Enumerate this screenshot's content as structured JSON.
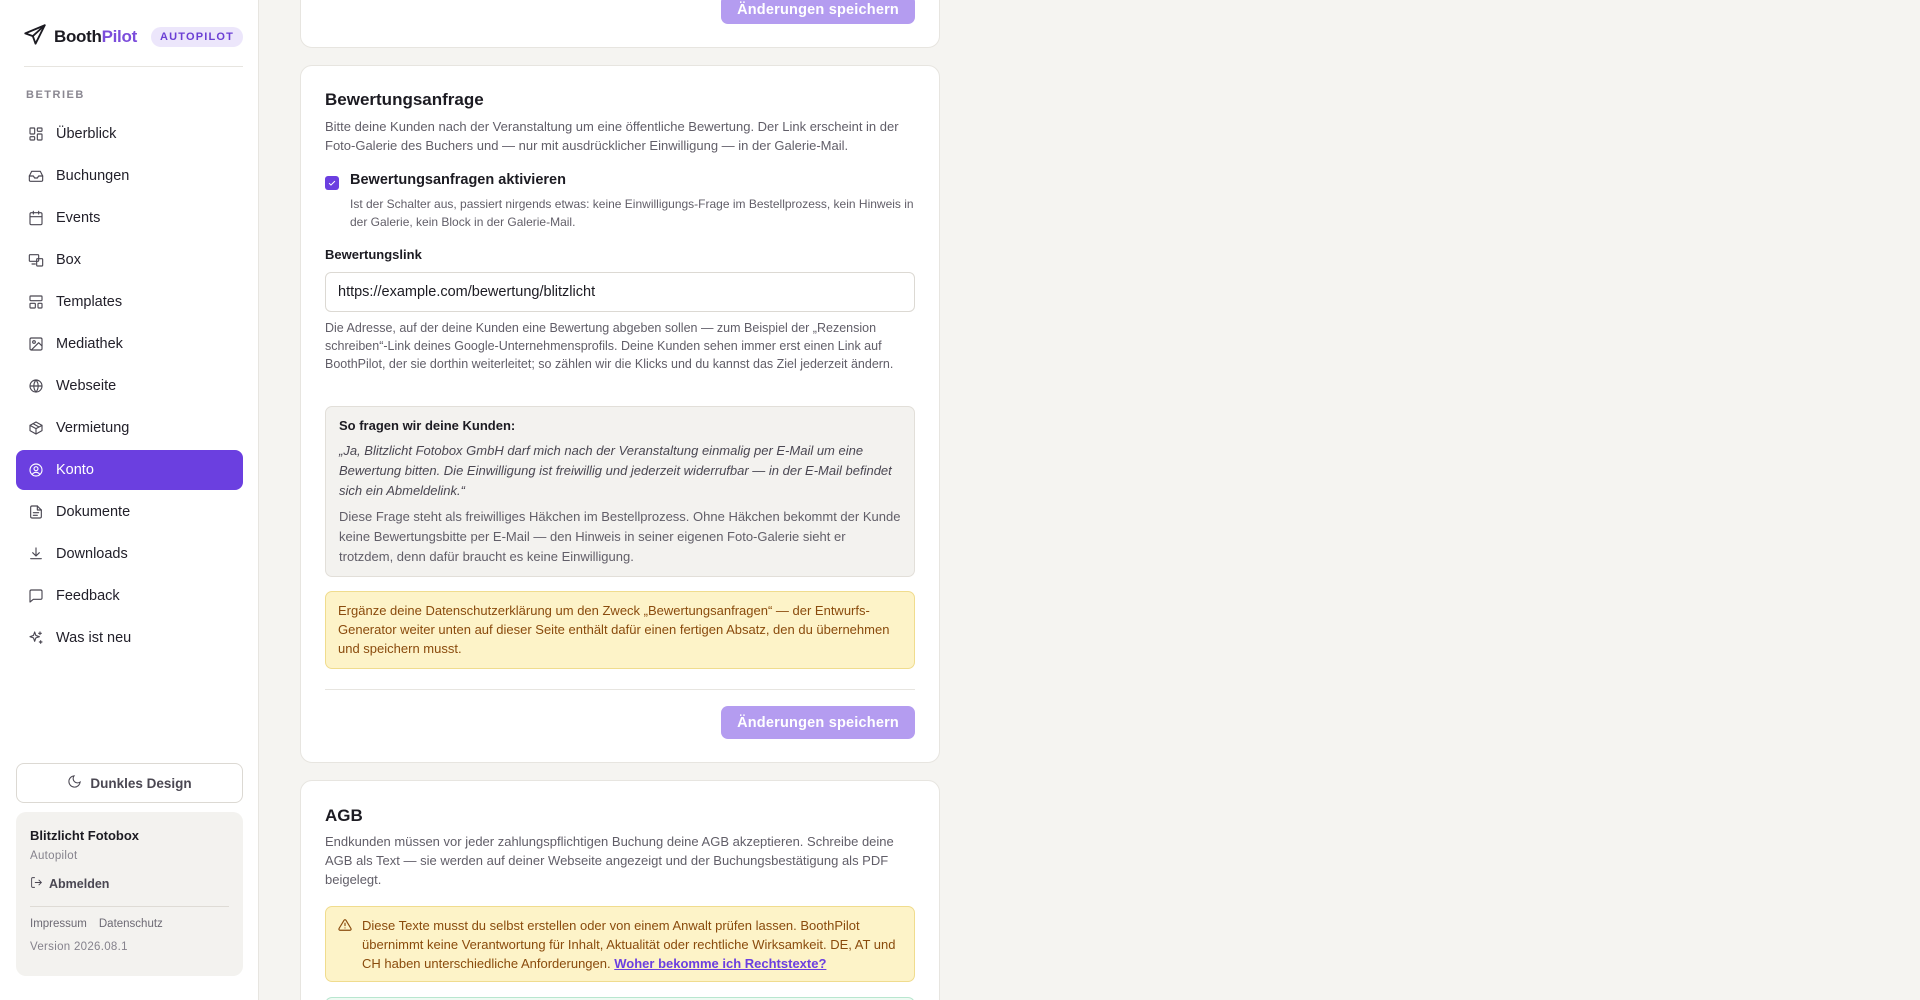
{
  "brand": {
    "name_part1": "Booth",
    "name_part2": "Pilot",
    "badge": "AUTOPILOT"
  },
  "sidebar": {
    "section": "BETRIEB",
    "items": [
      {
        "label": "Überblick",
        "icon": "dashboard-icon"
      },
      {
        "label": "Buchungen",
        "icon": "inbox-icon"
      },
      {
        "label": "Events",
        "icon": "calendar-icon"
      },
      {
        "label": "Box",
        "icon": "devices-icon"
      },
      {
        "label": "Templates",
        "icon": "layout-icon"
      },
      {
        "label": "Mediathek",
        "icon": "image-icon"
      },
      {
        "label": "Webseite",
        "icon": "globe-icon"
      },
      {
        "label": "Vermietung",
        "icon": "package-icon"
      },
      {
        "label": "Konto",
        "icon": "user-circle-icon",
        "active": true
      },
      {
        "label": "Dokumente",
        "icon": "file-icon"
      },
      {
        "label": "Downloads",
        "icon": "download-icon"
      },
      {
        "label": "Feedback",
        "icon": "message-icon"
      },
      {
        "label": "Was ist neu",
        "icon": "sparkles-icon"
      }
    ],
    "dark_mode_label": "Dunkles Design",
    "account": {
      "name": "Blitzlicht Fotobox",
      "plan": "Autopilot",
      "logout": "Abmelden",
      "imprint": "Impressum",
      "privacy": "Datenschutz",
      "version": "Version 2026.08.1"
    }
  },
  "top_card": {
    "save_label": "Änderungen speichern"
  },
  "review_card": {
    "title": "Bewertungsanfrage",
    "description": "Bitte deine Kunden nach der Veranstaltung um eine öffentliche Bewertung. Der Link erscheint in der Foto-Galerie des Buchers und — nur mit ausdrücklicher Einwilligung — in der Galerie-Mail.",
    "toggle_label": "Bewertungsanfragen aktivieren",
    "toggle_checked": true,
    "toggle_help": "Ist der Schalter aus, passiert nirgends etwas: keine Einwilligungs-Frage im Bestellprozess, kein Hinweis in der Galerie, kein Block in der Galerie-Mail.",
    "link_label": "Bewertungslink",
    "link_value": "https://example.com/bewertung/blitzlicht",
    "link_help": "Die Adresse, auf der deine Kunden eine Bewertung abgeben sollen — zum Beispiel der „Rezension schreiben“-Link deines Google-Unternehmensprofils. Deine Kunden sehen immer erst einen Link auf BoothPilot, der sie dorthin weiterleitet; so zählen wir die Klicks und du kannst das Ziel jederzeit ändern.",
    "ask_title": "So fragen wir deine Kunden:",
    "ask_quote": "„Ja, Blitzlicht Fotobox GmbH darf mich nach der Veranstaltung einmalig per E-Mail um eine Bewertung bitten. Die Einwilligung ist freiwillig und jederzeit widerrufbar — in der E-Mail befindet sich ein Abmeldelink.“",
    "ask_note": "Diese Frage steht als freiwilliges Häkchen im Bestellprozess. Ohne Häkchen bekommt der Kunde keine Bewertungsbitte per E-Mail — den Hinweis in seiner eigenen Foto-Galerie sieht er trotzdem, denn dafür braucht es keine Einwilligung.",
    "privacy_notice": "Ergänze deine Datenschutzerklärung um den Zweck „Bewertungsanfragen“ — der Entwurfs-Generator weiter unten auf dieser Seite enthält dafür einen fertigen Absatz, den du übernehmen und speichern musst.",
    "save_label": "Änderungen speichern"
  },
  "agb_card": {
    "title": "AGB",
    "description": "Endkunden müssen vor jeder zahlungspflichtigen Buchung deine AGB akzeptieren. Schreibe deine AGB als Text — sie werden auf deiner Webseite angezeigt und der Buchungsbestätigung als PDF beigelegt.",
    "warning": "Diese Texte musst du selbst erstellen oder von einem Anwalt prüfen lassen. BoothPilot übernimmt keine Verantwortung für Inhalt, Aktualität oder rechtliche Wirksamkeit. DE, AT und CH haben unterschiedliche Anforderungen.",
    "warning_link": "Woher bekomme ich Rechtstexte?"
  },
  "colors": {
    "accent": "#6b3fe0",
    "button_disabled": "#b49cf0",
    "warning_bg": "#fdf3c8",
    "warning_text": "#8a4b0d"
  }
}
